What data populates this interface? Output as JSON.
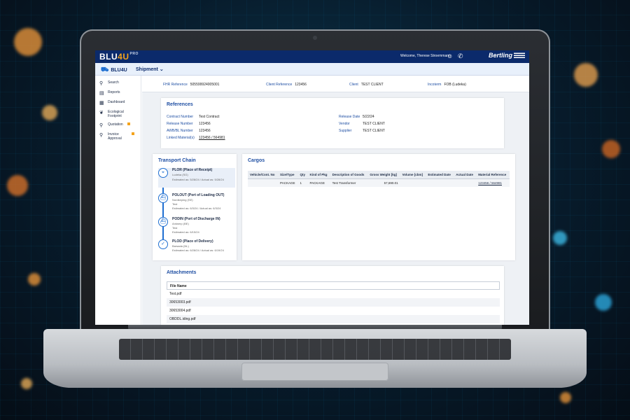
{
  "app": {
    "logo_main": "BLU",
    "logo_four": "4U",
    "logo_pro": "PRO",
    "welcome": "Welcome, Therese Stroemmann",
    "brand": "Bertling"
  },
  "nav": {
    "app_name": "BLU4U",
    "menu": "Shipment"
  },
  "sidebar": {
    "items": [
      {
        "label": "Search",
        "icon": "search-icon"
      },
      {
        "label": "Reports",
        "icon": "document-icon"
      },
      {
        "label": "Dashboard",
        "icon": "chart-icon"
      },
      {
        "label": "Ecological Footprint",
        "icon": "leaf-icon"
      },
      {
        "label": "Quotation",
        "icon": "search-icon"
      },
      {
        "label": "Invoice Approval",
        "icon": "search-icon"
      }
    ]
  },
  "refbar": {
    "fhr_label": "FHR Reference",
    "fhr_value": "505599924005001",
    "client_ref_label": "Client Reference",
    "client_ref_value": "123456",
    "client_label": "Client",
    "client_value": "TEST CLIENT",
    "incoterm_label": "Incoterm",
    "incoterm_value": "FOB (Ludeka)"
  },
  "references": {
    "title": "References",
    "left": [
      {
        "label": "Contract Number",
        "value": "Test Contract"
      },
      {
        "label": "Release Number",
        "value": "123456"
      },
      {
        "label": "AWB/BL Number",
        "value": "123456"
      },
      {
        "label": "Linked Material(s)",
        "value": "123456 / 564981"
      }
    ],
    "right": [
      {
        "label": "Release Date",
        "value": "5/22/24"
      },
      {
        "label": "Vendor",
        "value": "TEST CLIENT"
      },
      {
        "label": "Supplier",
        "value": "TEST CLIENT"
      }
    ]
  },
  "transport": {
    "title": "Transport Chain",
    "stops": [
      {
        "title": "PLOR (Place of Receipt)",
        "sub1": "Ludeka (SG)",
        "sub2": "Estimated as: 5/28/24 / Actual as: 5/28/24",
        "icon": "location-icon",
        "glyph": "⌖"
      },
      {
        "title": "POLOUT (Port of Loading OUT)",
        "sub1": "Nordkeping (SE)",
        "sub2": "Test",
        "sub3": "Estimated as: 6/3/24 / Actual as: 6/3/24",
        "icon": "ship-icon",
        "glyph": "⛴"
      },
      {
        "title": "PODIN (Port of Discharge IN)",
        "sub1": "Antwerp (BE)",
        "sub2": "Test",
        "sub3": "Estimated as: 6/15/24",
        "icon": "ship-icon",
        "glyph": "⛴"
      },
      {
        "title": "PLOD (Place of Delivery)",
        "sub1": "Barsada (NL)",
        "sub2": "Estimated as: 6/28/24 / Actual as: 6/19/24",
        "icon": "check-icon",
        "glyph": "✓"
      }
    ]
  },
  "cargos": {
    "title": "Cargos",
    "columns": [
      "Vehicle/Cont. No",
      "Size/Type",
      "Qty",
      "Kind of Pkg",
      "Description of Goods",
      "Gross Weight [kg]",
      "Volume [cbm]",
      "Estimated Date",
      "Actual Date",
      "Material Reference"
    ],
    "rows": [
      [
        "",
        "PACKAGE",
        "1",
        "PACKAGE",
        "Test Transformer",
        "57,690.01",
        "",
        "",
        "",
        "123456 / 564981"
      ]
    ]
  },
  "attachments": {
    "title": "Attachments",
    "column": "File Name",
    "files": [
      "Test.pdf",
      "30653003.pdf",
      "30653004.pdf",
      "OBDDL.iding.pdf"
    ]
  }
}
